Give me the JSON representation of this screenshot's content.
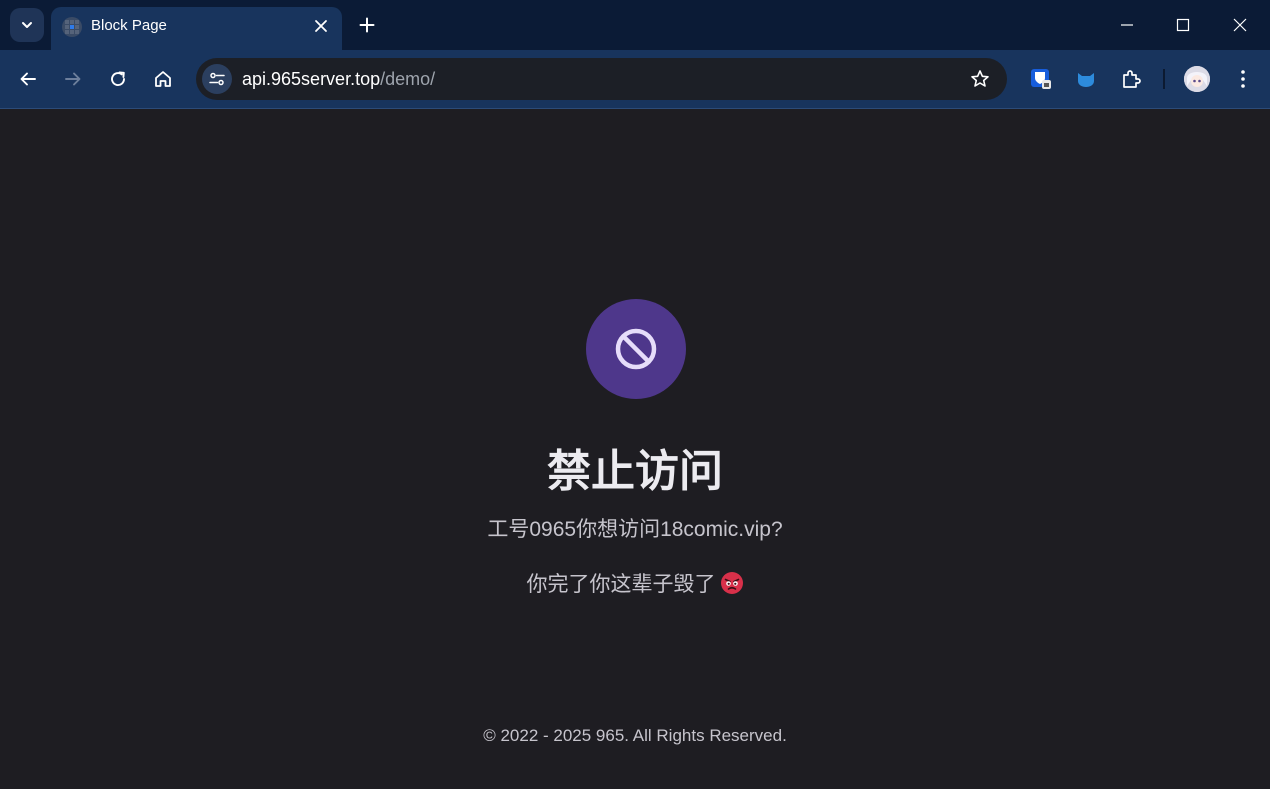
{
  "browser": {
    "tab": {
      "title": "Block Page"
    },
    "address_bar": {
      "host": "api.965server.top",
      "path": "/demo/"
    },
    "icons": {
      "tab_search": "chevron-down-icon",
      "favicon": "grid-globe-icon",
      "tab_close": "close-icon",
      "new_tab": "plus-icon",
      "back": "arrow-left-icon",
      "forward": "arrow-right-icon",
      "reload": "reload-icon",
      "home": "home-icon",
      "site_info": "tune-icon",
      "bookmark": "star-icon",
      "extensions": [
        "bitwarden-icon",
        "cat-icon",
        "puzzle-icon"
      ],
      "menu": "kebab-menu-icon"
    },
    "colors": {
      "tabstrip": "#0b1b36",
      "toolbar": "#18345d",
      "omnibox": "#1c1f26"
    }
  },
  "page": {
    "heading": "禁止访问",
    "message": "工号0965你想访问18comic.vip?",
    "submessage": "你完了你这辈子毁了",
    "footer": "© 2022 - 2025 965. All Rights Reserved.",
    "icons": {
      "block": "block-icon",
      "emoji": "angry-face-icon"
    },
    "colors": {
      "background": "#1e1d22",
      "accent": "#4e378b",
      "accent_icon": "#e6ddfa"
    }
  }
}
